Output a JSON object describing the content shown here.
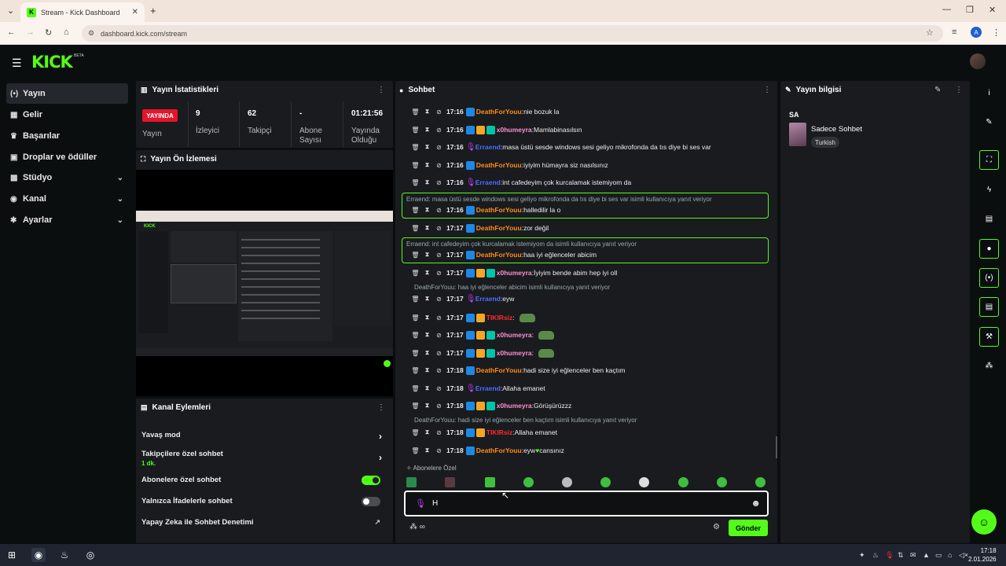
{
  "browser": {
    "tab_title": "Stream - Kick Dashboard",
    "url": "dashboard.kick.com/stream",
    "profile_initial": "A"
  },
  "header": {
    "logo": "KICK",
    "beta": "BETA"
  },
  "sidebar": {
    "items": [
      {
        "label": "Yayın",
        "icon": "broadcast-icon",
        "glyph": "(•)",
        "active": true
      },
      {
        "label": "Gelir",
        "icon": "revenue-icon",
        "glyph": "▦"
      },
      {
        "label": "Başarılar",
        "icon": "trophy-icon",
        "glyph": "♛"
      },
      {
        "label": "Droplar ve ödüller",
        "icon": "gift-icon",
        "glyph": "▣"
      },
      {
        "label": "Stüdyo",
        "icon": "studio-icon",
        "glyph": "▩",
        "chevron": true
      },
      {
        "label": "Kanal",
        "icon": "channel-icon",
        "glyph": "◉",
        "chevron": true
      },
      {
        "label": "Ayarlar",
        "icon": "settings-icon",
        "glyph": "✱",
        "chevron": true
      }
    ]
  },
  "stats": {
    "title": "Yayın İstatistikleri",
    "live_badge": "YAYINDA",
    "live_label": "Yayın",
    "viewers_value": "9",
    "viewers_label": "İzleyici",
    "followers_value": "62",
    "followers_label": "Takipçi",
    "subs_value": "-",
    "subs_label": "Abone Sayısı",
    "uptime_value": "01:21:56",
    "uptime_label": "Yayında Olduğu"
  },
  "preview": {
    "title": "Yayın Ön İzlemesi"
  },
  "actions": {
    "title": "Kanal Eylemleri",
    "rows": [
      {
        "label": "Yavaş mod",
        "control": "arrow"
      },
      {
        "label": "Takipçilere özel sohbet",
        "sub": "1 dk.",
        "control": "arrow"
      },
      {
        "label": "Abonelere özel sohbet",
        "control": "toggle-on"
      },
      {
        "label": "Yalnızca İfadelerle sohbet",
        "control": "toggle-off"
      },
      {
        "label": "Yapay Zeka ile Sohbet Denetimi",
        "control": "external"
      }
    ]
  },
  "chat": {
    "title": "Sohbet",
    "colors": {
      "orange": "#ff8c1a",
      "pink": "#ff8fcf",
      "blue": "#4b6fff",
      "red": "#ff2a2a",
      "green": "#53fc18"
    },
    "messages": [
      {
        "time": "17:16",
        "user": "DeathForYouu",
        "color": "#ff8c1a",
        "badges": [
          "mod"
        ],
        "text": "nie bozuk la"
      },
      {
        "time": "17:16",
        "user": "x0humeyra",
        "color": "#ff8fcf",
        "badges": [
          "mod",
          "sub",
          "og"
        ],
        "text": "Mamlabinasılsın"
      },
      {
        "time": "17:16",
        "user": "Erraend",
        "color": "#4b6fff",
        "badges": [
          "mic"
        ],
        "text": "masa üstü sesde windows sesi geliyo mikrofonda da tıs diye bi ses var"
      },
      {
        "time": "17:16",
        "user": "DeathForYouu",
        "color": "#ff8c1a",
        "badges": [
          "mod"
        ],
        "text": "iyiyim hümayra siz nasılsınız"
      },
      {
        "time": "17:16",
        "user": "Erraend",
        "color": "#4b6fff",
        "badges": [
          "mic"
        ],
        "text": "int cafedeyim çok kurcalamak istemiyom da"
      },
      {
        "reply": "Erraend: masa üstü sesde windows sesi geliyo mikrofonda da tıs diye bi ses var isimli kullanıcıya yanıt veriyor",
        "time": "17:16",
        "user": "DeathForYouu",
        "color": "#ff8c1a",
        "badges": [
          "mod"
        ],
        "text": "halledilir la o"
      },
      {
        "time": "17:17",
        "user": "DeathForYouu",
        "color": "#ff8c1a",
        "badges": [
          "mod"
        ],
        "text": "zor değil"
      },
      {
        "reply": "Erraend: int cafedeyim çok kurcalamak istemiyom da isimli kullanıcıya yanıt veriyor",
        "time": "17:17",
        "user": "DeathForYouu",
        "color": "#ff8c1a",
        "badges": [
          "mod"
        ],
        "text": "haa iyi eğlenceler abicim"
      },
      {
        "time": "17:17",
        "user": "x0humeyra",
        "color": "#ff8fcf",
        "badges": [
          "mod",
          "sub",
          "og"
        ],
        "text": "İyiyim bende abim hep iyi oll"
      },
      {
        "reply_plain": "DeathForYouu: haa iyi eğlenceler abicim isimli kullanıcıya yanıt veriyor",
        "time": "17:17",
        "user": "Erraend",
        "color": "#4b6fff",
        "badges": [
          "mic"
        ],
        "text": "eyw"
      },
      {
        "time": "17:17",
        "user": "TIKIRsiz",
        "color": "#ff2a2a",
        "badges": [
          "mod",
          "sub"
        ],
        "text": "",
        "emote": true
      },
      {
        "time": "17:17",
        "user": "x0humeyra",
        "color": "#ff8fcf",
        "badges": [
          "mod",
          "sub",
          "og"
        ],
        "text": "",
        "emote": true
      },
      {
        "time": "17:17",
        "user": "x0humeyra",
        "color": "#ff8fcf",
        "badges": [
          "mod",
          "sub",
          "og"
        ],
        "text": "",
        "emote": true
      },
      {
        "time": "17:18",
        "user": "DeathForYouu",
        "color": "#ff8c1a",
        "badges": [
          "mod"
        ],
        "text": "hadi size iyi eğlenceler ben kaçtım"
      },
      {
        "time": "17:18",
        "user": "Erraend",
        "color": "#4b6fff",
        "badges": [
          "mic"
        ],
        "text": "Allaha emanet"
      },
      {
        "time": "17:18",
        "user": "x0humeyra",
        "color": "#ff8fcf",
        "badges": [
          "mod",
          "sub",
          "og"
        ],
        "text": "Görüşürüzzz"
      },
      {
        "reply_plain": "DeathForYouu: hadi size iyi eğlenceler ben kaçtım isimli kullanıcıya yanıt veriyor",
        "time": "17:18",
        "user": "TIKIRsiz",
        "color": "#ff2a2a",
        "badges": [
          "mod",
          "sub"
        ],
        "text": "Allaha emanet"
      },
      {
        "time": "17:18",
        "user": "DeathForYouu",
        "color": "#ff8c1a",
        "badges": [
          "mod"
        ],
        "text": "eyw ",
        "heart": "♥",
        "text2": " cansınız"
      }
    ],
    "subs_only_label": "Abonelere Özel",
    "input_value": "H",
    "send_label": "Gönder"
  },
  "info": {
    "title": "Yayın bilgisi",
    "stream_title": "SA",
    "category": "Sadece Sohbet",
    "language": "Turkish"
  },
  "taskbar": {
    "time": "17:18",
    "date": "2.01.2026"
  }
}
